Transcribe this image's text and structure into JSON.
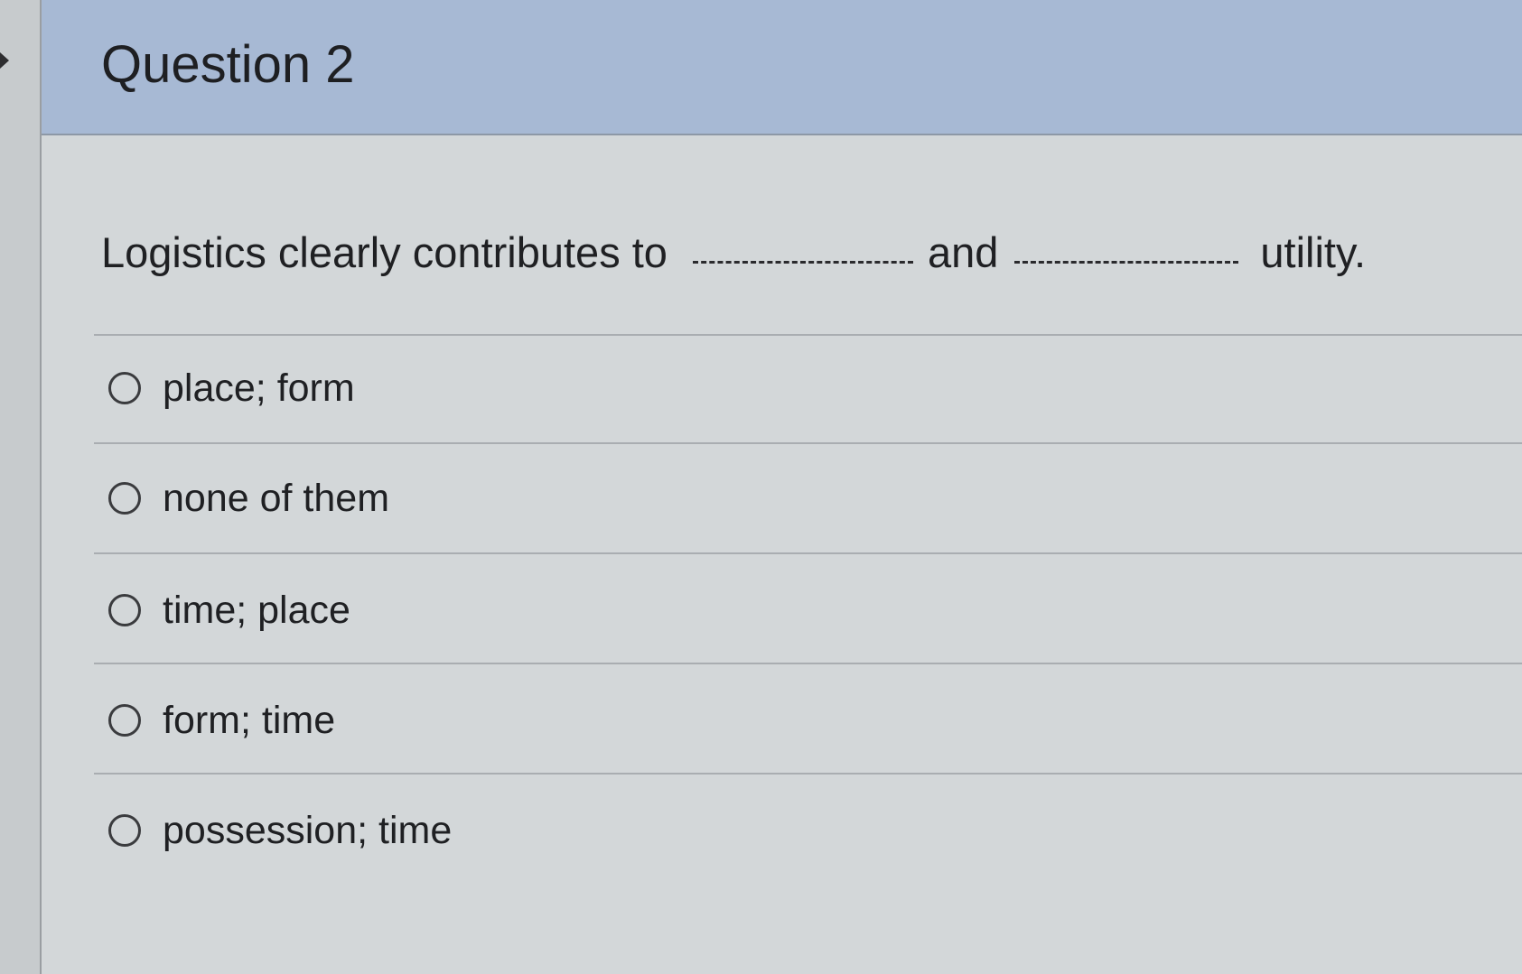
{
  "question": {
    "title": "Question 2",
    "text_before": "Logistics clearly contributes to",
    "text_middle": "and",
    "text_after": "utility."
  },
  "answers": [
    {
      "label": "place; form",
      "selected": false
    },
    {
      "label": "none of them",
      "selected": false
    },
    {
      "label": "time; place",
      "selected": false
    },
    {
      "label": "form; time",
      "selected": false
    },
    {
      "label": "possession; time",
      "selected": false
    }
  ],
  "colors": {
    "header_background": "#a7b9d4",
    "card_background": "#d3d7d9",
    "text": "#1f2023"
  },
  "icons": {
    "collapse": "collapse-arrow-icon",
    "radio": "radio-button-icon"
  }
}
